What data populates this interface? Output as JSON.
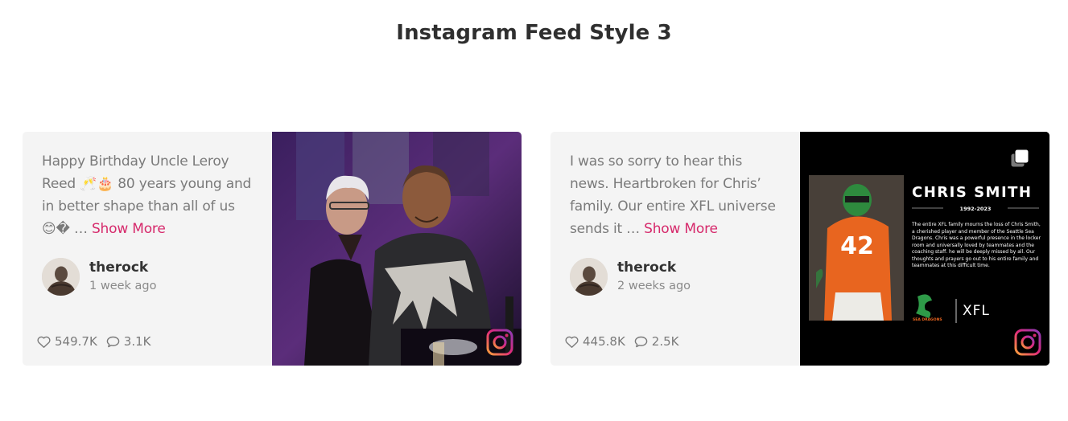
{
  "page": {
    "title": "Instagram Feed Style 3"
  },
  "posts": [
    {
      "caption": "Happy Birthday Uncle Leroy Reed 🥂🎂 80 years young and in better shape than all of us 😊� … ",
      "show_more": "Show More",
      "username": "therock",
      "time": "1 week ago",
      "likes": "549.7K",
      "comments": "3.1K"
    },
    {
      "caption": "I was so sorry to hear this news. Heartbroken for Chris’ family. Our entire XFL universe sends it … ",
      "show_more": "Show More",
      "username": "therock",
      "time": "2 weeks ago",
      "likes": "445.8K",
      "comments": "2.5K",
      "image_text": {
        "name": "CHRIS SMITH",
        "years": "1992-2023",
        "jersey": "42",
        "body": "The entire XFL family mourns the loss of Chris Smith, a cherished player and member of the Seattle Sea Dragons. Chris was a powerful presence in the locker room and universally loved by teammates and the coaching staff. he will be deeply missed by all. Our thoughts and prayers go out to his entire family and teammates at this difficult time.",
        "team": "SEA DRAGONS",
        "league": "XFL"
      }
    }
  ],
  "colors": {
    "accent": "#d6296b",
    "card_bg": "#f4f4f4",
    "text_muted": "#7a7a7a"
  },
  "icons": [
    "heart-icon",
    "comment-icon",
    "instagram-icon",
    "multiple-images-icon"
  ]
}
